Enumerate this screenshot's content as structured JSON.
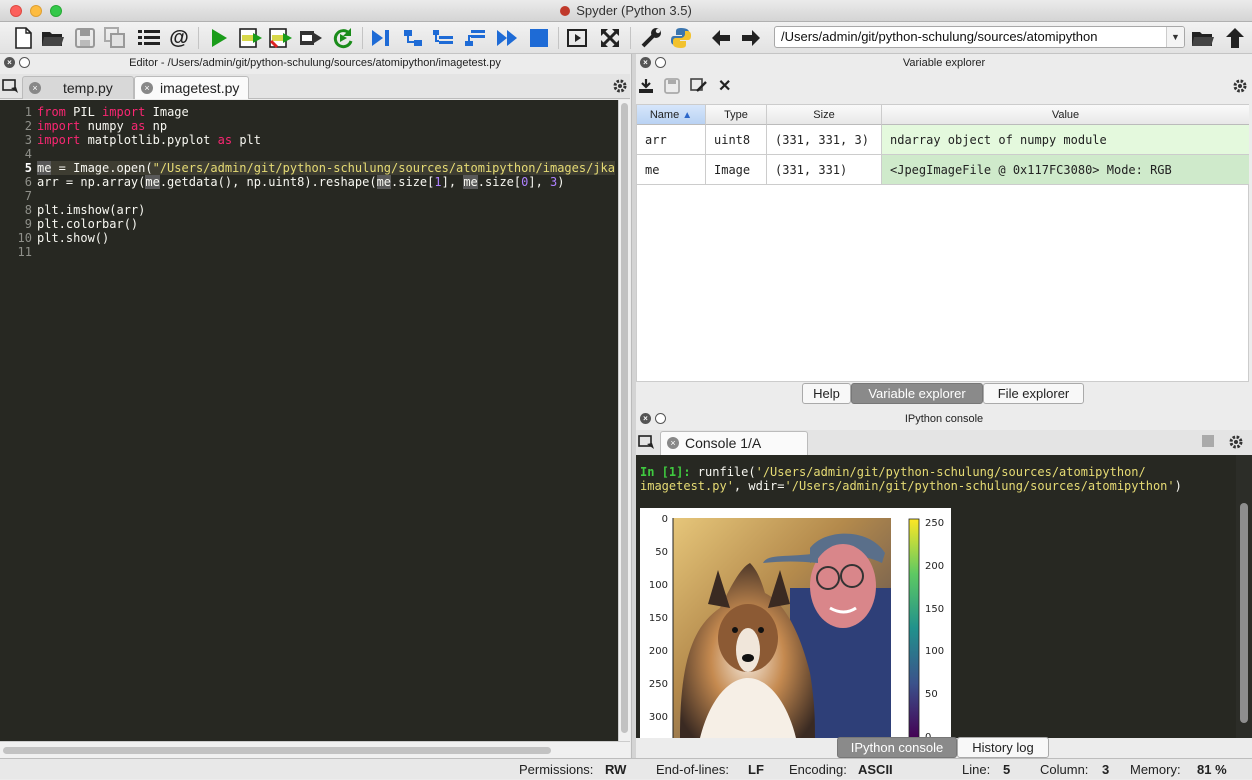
{
  "window": {
    "title": "Spyder (Python 3.5)"
  },
  "toolbar": {
    "path": "/Users/admin/git/python-schulung/sources/atomipython",
    "icons": [
      "new-file-icon",
      "open-file-icon",
      "save-icon",
      "save-all-icon",
      "list-icon",
      "at-icon",
      "run-icon",
      "run-cell-icon",
      "run-cell-advance-icon",
      "run-selection-icon",
      "rerun-icon",
      "debug-icon",
      "step-icon",
      "step-into-icon",
      "step-return-icon",
      "continue-icon",
      "stop-icon",
      "maximize-icon",
      "fullscreen-icon",
      "preferences-icon",
      "python-path-icon",
      "back-icon",
      "forward-icon",
      "browse-folder-icon",
      "parent-folder-icon"
    ]
  },
  "editor": {
    "header": "Editor - /Users/admin/git/python-schulung/sources/atomipython/imagetest.py",
    "tabs": [
      {
        "label": "temp.py"
      },
      {
        "label": "imagetest.py"
      }
    ],
    "line_numbers": [
      "1",
      "2",
      "3",
      "4",
      "5",
      "6",
      "7",
      "8",
      "9",
      "10",
      "11"
    ],
    "current_line": 5
  },
  "variable_explorer": {
    "header": "Variable explorer",
    "columns": [
      "Name",
      "Type",
      "Size",
      "Value"
    ],
    "rows": [
      {
        "name": "arr",
        "type": "uint8",
        "size": "(331, 331, 3)",
        "value": "ndarray object of numpy module"
      },
      {
        "name": "me",
        "type": "Image",
        "size": "(331, 331)",
        "value": "<JpegImageFile @ 0x117FC3080>  Mode: RGB"
      }
    ],
    "tabs": [
      "Help",
      "Variable explorer",
      "File explorer"
    ],
    "selected_tab": "Variable explorer"
  },
  "console": {
    "header": "IPython console",
    "tab_label": "Console 1/A",
    "prompt": "In [1]:",
    "command_pre": " runfile(",
    "arg1": "'/Users/admin/git/python-schulung/sources/atomipython/",
    "arg1b": "imagetest.py'",
    "command_mid": ", wdir=",
    "arg2": "'/Users/admin/git/python-schulung/sources/atomipython'",
    "command_end": ")",
    "figure": {
      "y_ticks": [
        "0",
        "50",
        "100",
        "150",
        "200",
        "250",
        "300"
      ],
      "colorbar_ticks": [
        "250",
        "200",
        "150",
        "100",
        "50",
        "0"
      ]
    },
    "tabs": [
      "IPython console",
      "History log"
    ],
    "selected_tab": "IPython console"
  },
  "statusbar": {
    "permissions_label": "Permissions:",
    "permissions": "RW",
    "eol_label": "End-of-lines:",
    "eol": "LF",
    "encoding_label": "Encoding:",
    "encoding": "ASCII",
    "line_label": "Line:",
    "line": "5",
    "column_label": "Column:",
    "column": "3",
    "memory_label": "Memory:",
    "memory": "81 %"
  }
}
